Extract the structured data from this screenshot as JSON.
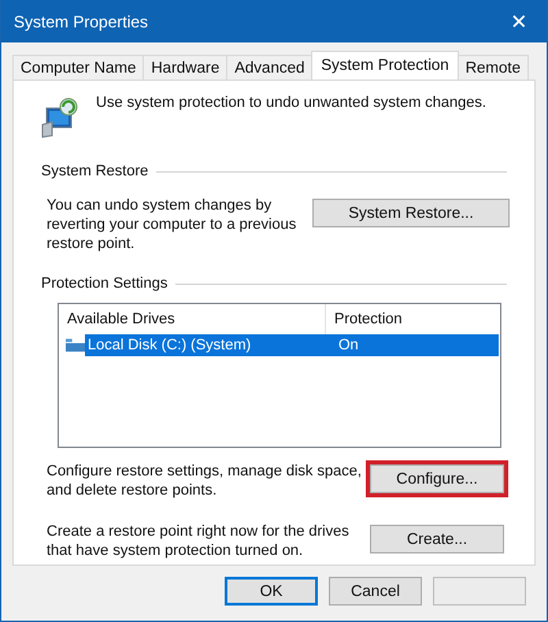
{
  "window": {
    "title": "System Properties",
    "close": "✕"
  },
  "tabs": [
    {
      "label": "Computer Name",
      "selected": false
    },
    {
      "label": "Hardware",
      "selected": false
    },
    {
      "label": "Advanced",
      "selected": false
    },
    {
      "label": "System Protection",
      "selected": true
    },
    {
      "label": "Remote",
      "selected": false
    }
  ],
  "intro": "Use system protection to undo unwanted system changes.",
  "system_restore": {
    "heading": "System Restore",
    "text": "You can undo system changes by reverting your computer to a previous restore point.",
    "button": "System Restore..."
  },
  "protection": {
    "heading": "Protection Settings",
    "columns": [
      "Available Drives",
      "Protection"
    ],
    "rows": [
      {
        "drive": "Local Disk (C:) (System)",
        "protection": "On",
        "selected": true
      }
    ],
    "actions": [
      {
        "text": "Configure restore settings, manage disk space, and delete restore points.",
        "button": "Configure...",
        "highlighted": true
      },
      {
        "text": "Create a restore point right now for the drives that have system protection turned on.",
        "button": "Create...",
        "highlighted": false
      }
    ]
  },
  "buttons": [
    {
      "label": "OK",
      "default": true,
      "disabled": false
    },
    {
      "label": "Cancel",
      "default": false,
      "disabled": false
    },
    {
      "default": false,
      "disabled": true
    }
  ]
}
